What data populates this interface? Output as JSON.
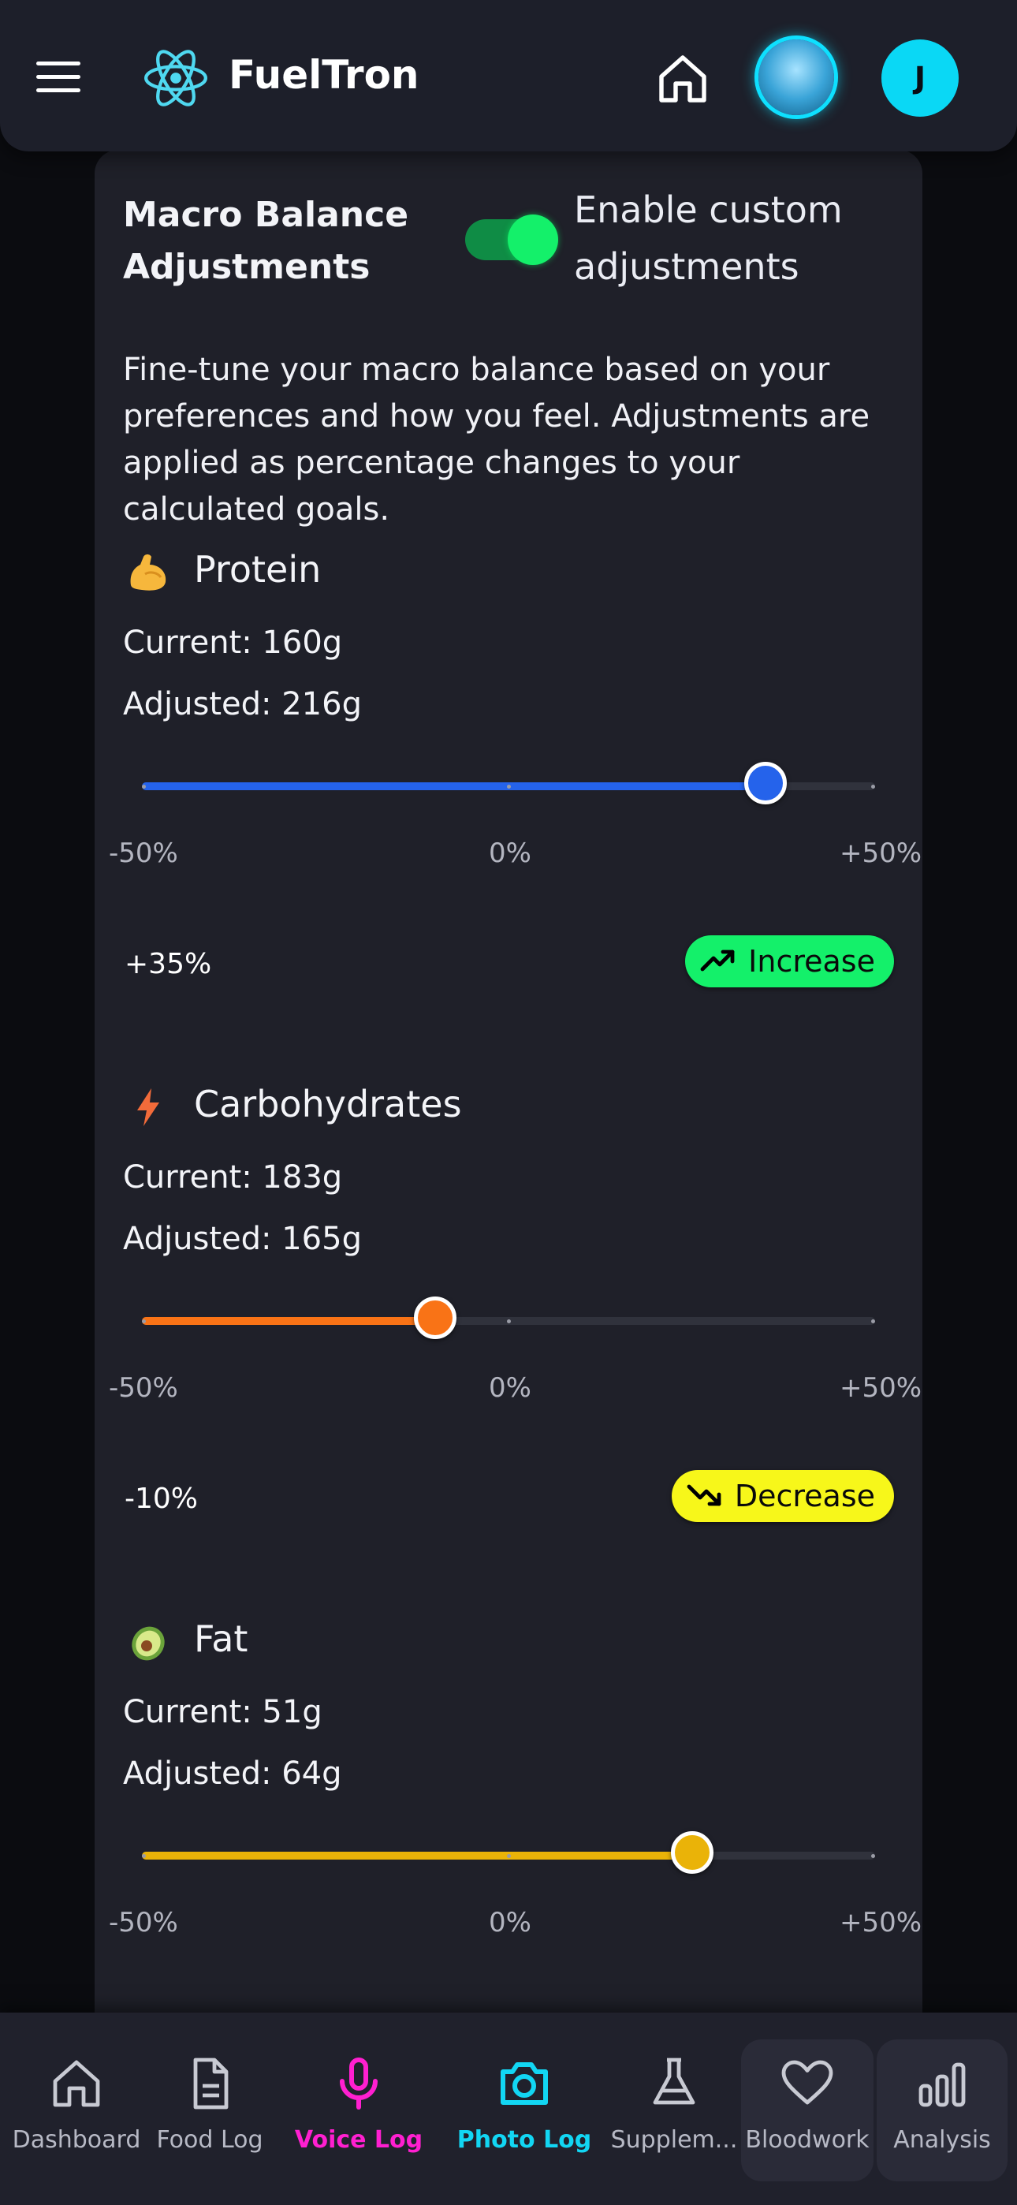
{
  "header": {
    "brand": "FuelTron",
    "user_initial": "J"
  },
  "card": {
    "title": "Macro Balance Adjustments",
    "toggle_label": "Enable custom adjustments",
    "toggle_on": true,
    "description": "Fine-tune your macro balance based on your preferences and how you feel. Adjustments are applied as percentage changes to your calculated goals."
  },
  "slider_ticks": {
    "min": "-50%",
    "mid": "0%",
    "max": "+50%"
  },
  "macros": [
    {
      "name": "Protein",
      "icon": "flexed-biceps-icon",
      "current": "Current: 160g",
      "adjusted": "Adjusted: 216g",
      "adjustment_pct": 35,
      "adjustment_label": "+35%",
      "trend": "Increase",
      "color": "#2563eb"
    },
    {
      "name": "Carbohydrates",
      "icon": "lightning-bolt-icon",
      "current": "Current: 183g",
      "adjusted": "Adjusted: 165g",
      "adjustment_pct": -10,
      "adjustment_label": "-10%",
      "trend": "Decrease",
      "color": "#f97316"
    },
    {
      "name": "Fat",
      "icon": "avocado-icon",
      "current": "Current: 51g",
      "adjusted": "Adjusted: 64g",
      "adjustment_pct": 25,
      "adjustment_label": "",
      "trend": "",
      "color": "#eab308"
    }
  ],
  "nav": {
    "items": [
      {
        "label": "Dashboard",
        "icon": "home-icon"
      },
      {
        "label": "Food Log",
        "icon": "document-icon"
      },
      {
        "label": "Voice Log",
        "icon": "microphone-icon",
        "color": "#ff1fd0"
      },
      {
        "label": "Photo Log",
        "icon": "camera-icon",
        "color": "#12d6f3"
      },
      {
        "label": "Supplem...",
        "icon": "flask-icon"
      },
      {
        "label": "Bloodwork",
        "icon": "heart-icon"
      },
      {
        "label": "Analysis",
        "icon": "bar-chart-icon"
      }
    ]
  }
}
